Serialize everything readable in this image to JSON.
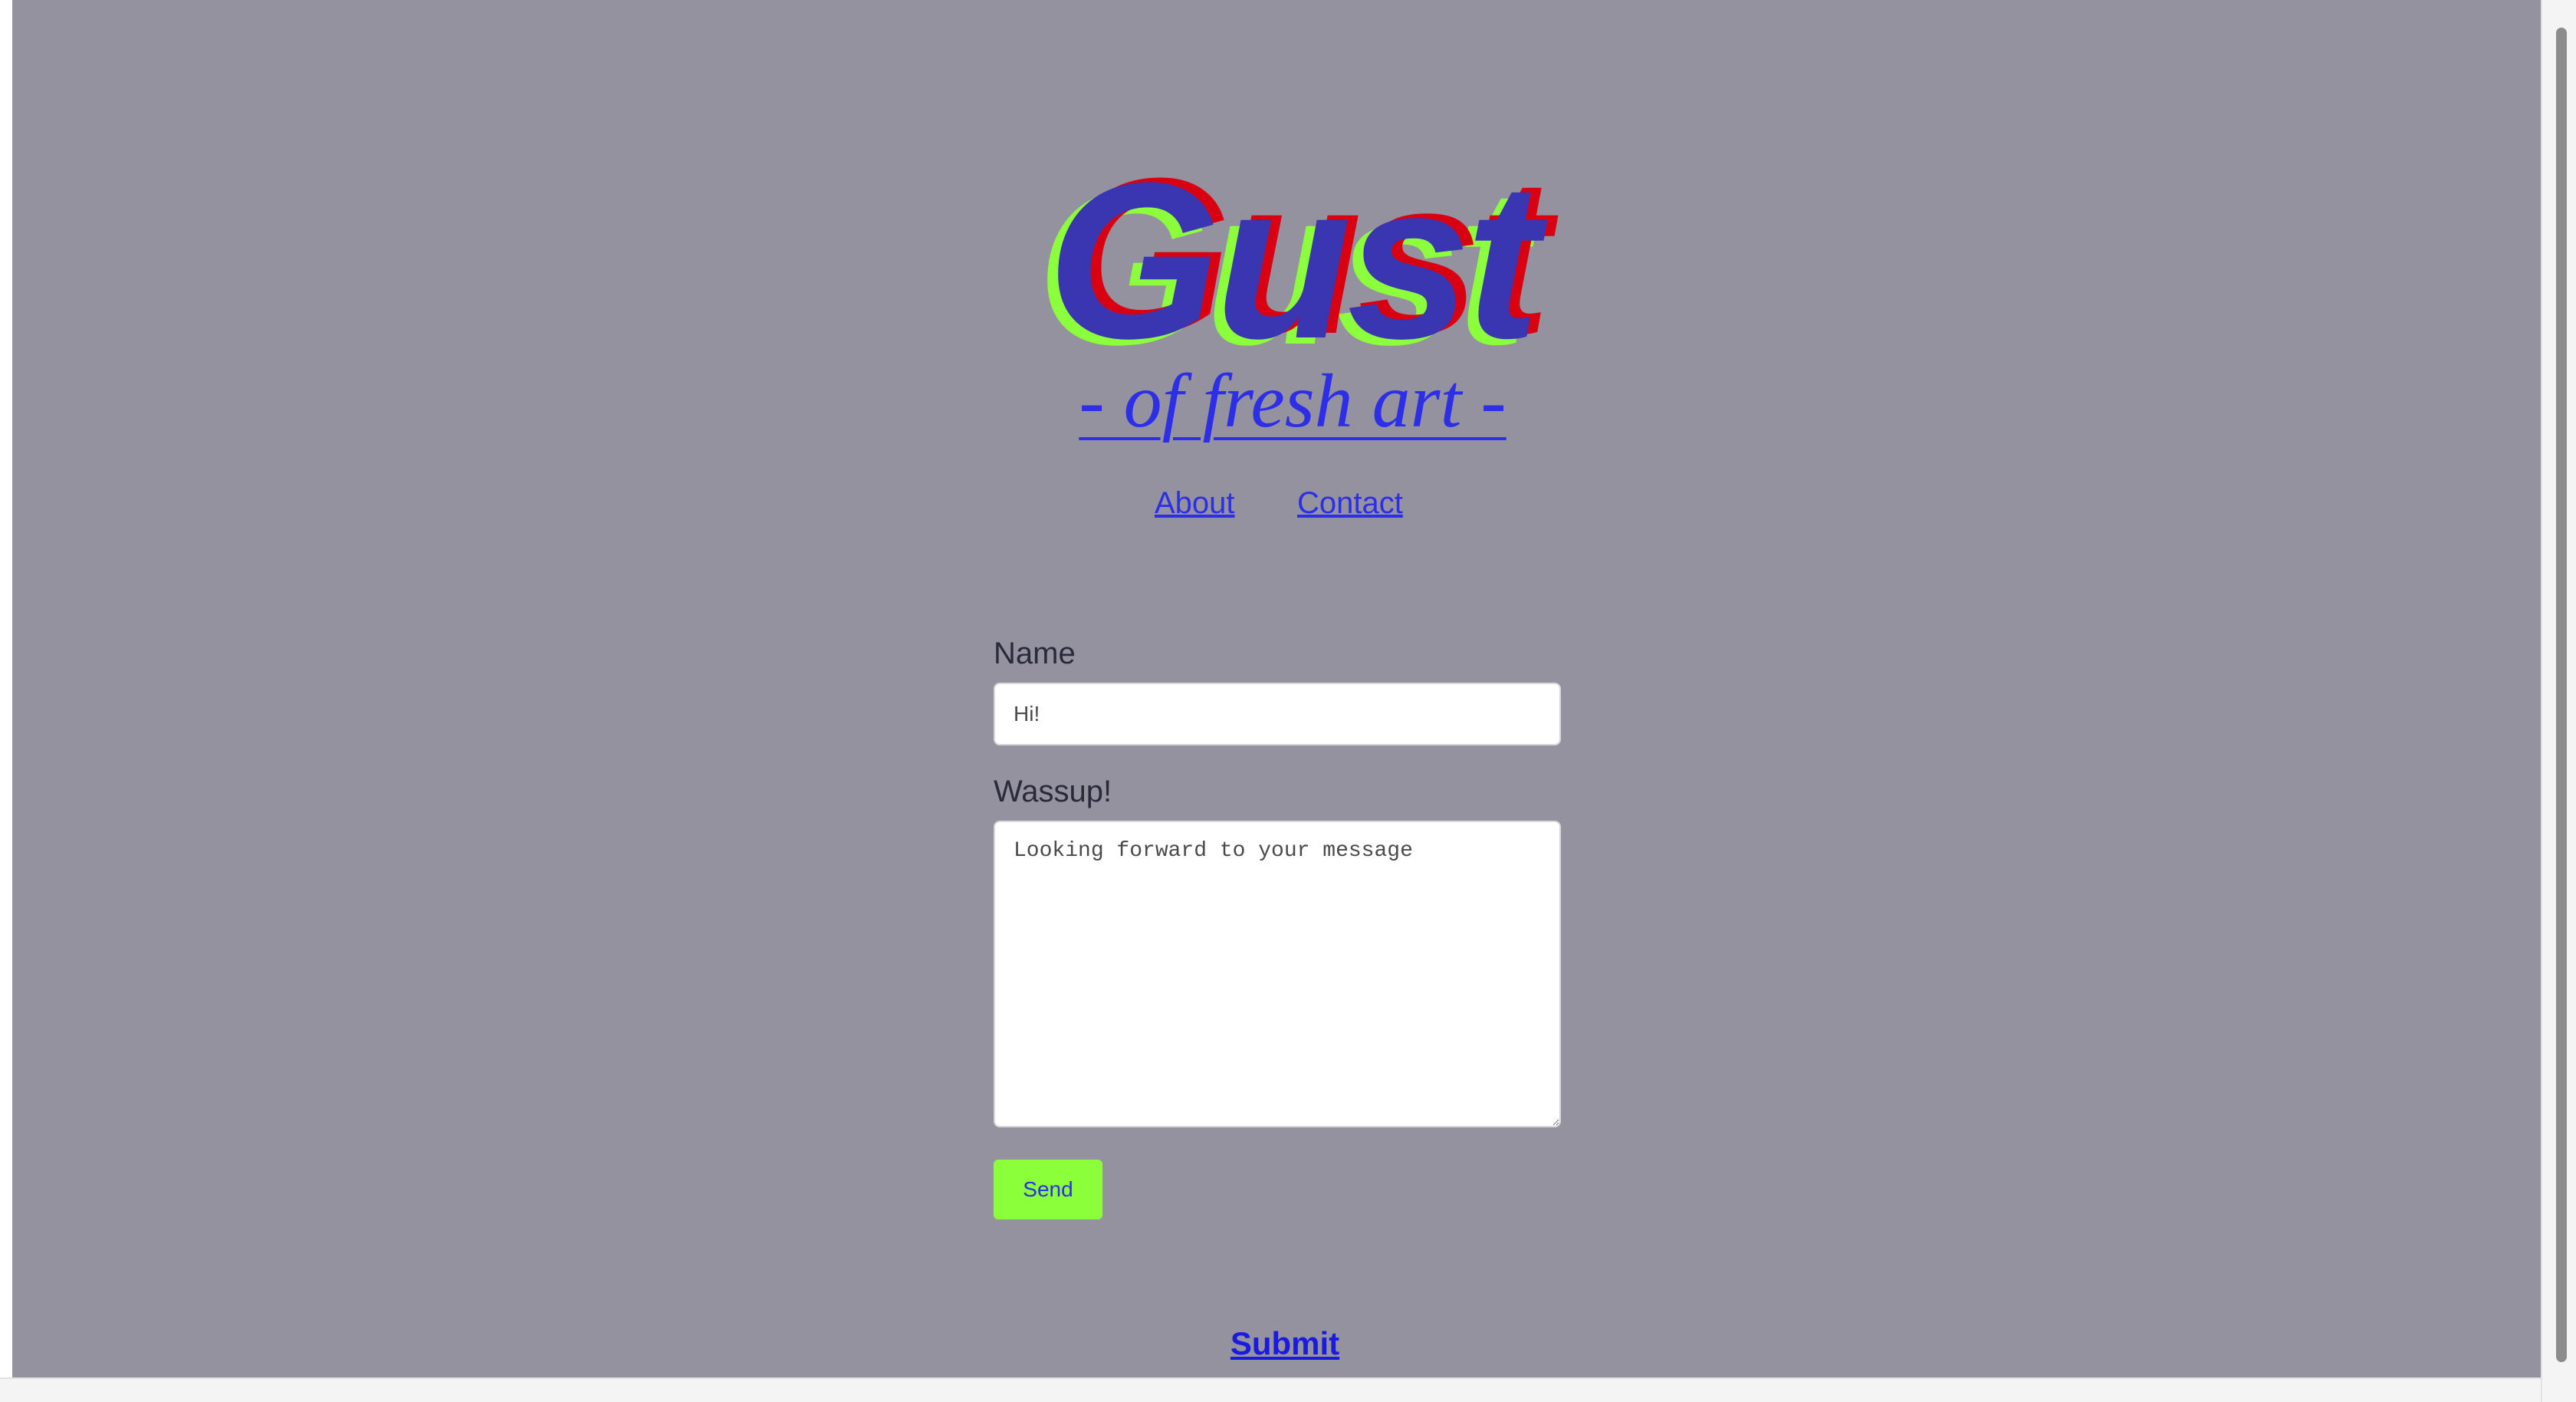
{
  "header": {
    "logo_text": "Gust",
    "tagline": "- of fresh art -"
  },
  "nav": {
    "about": "About",
    "contact": "Contact"
  },
  "form": {
    "name_label": "Name",
    "name_placeholder": "Hi!",
    "message_label": "Wassup!",
    "message_placeholder": "Looking forward to your message",
    "send_label": "Send"
  },
  "footer": {
    "submit_label": "Submit"
  },
  "colors": {
    "background": "#94929f",
    "logo_blue": "#3a35b0",
    "logo_red": "#d90012",
    "logo_green": "#8cff3c",
    "link": "#2d2ee8",
    "send_button": "#8aff3a"
  }
}
